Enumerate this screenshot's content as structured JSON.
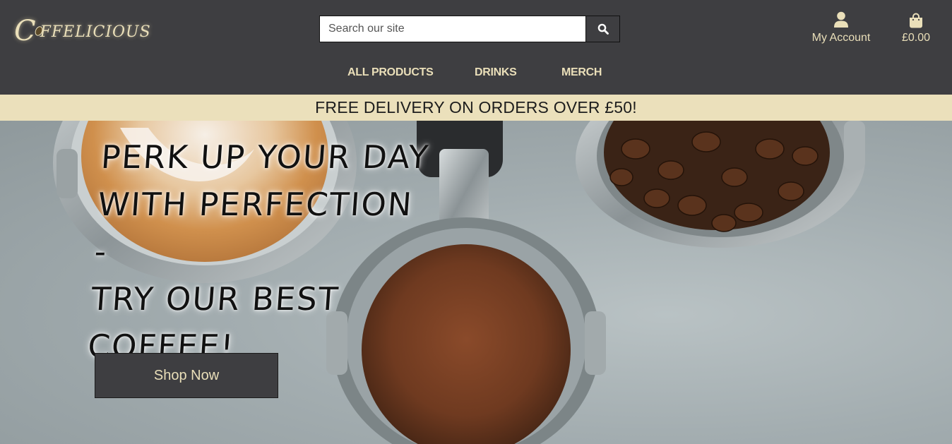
{
  "brand": {
    "logo_initial": "C",
    "logo_rest": "FFELICIOUS"
  },
  "search": {
    "placeholder": "Search our site",
    "value": ""
  },
  "account": {
    "label": "My Account",
    "icon": "user-icon"
  },
  "bag": {
    "total": "£0.00",
    "icon": "shopping-bag-icon"
  },
  "nav": {
    "items": [
      {
        "label": "ALL PRODUCTS"
      },
      {
        "label": "DRINKS"
      },
      {
        "label": "MERCH"
      }
    ]
  },
  "banner": {
    "text": "FREE DELIVERY ON ORDERS OVER £50!"
  },
  "hero": {
    "headline_lines": [
      "PERK UP YOUR DAY",
      "WITH PERFECTION -",
      "TRY OUR BEST",
      "COFFEE!"
    ],
    "cta_label": "Shop Now"
  },
  "colors": {
    "header_bg": "#3e3e41",
    "accent": "#eadfb9",
    "banner_bg": "#ebe0bb"
  }
}
